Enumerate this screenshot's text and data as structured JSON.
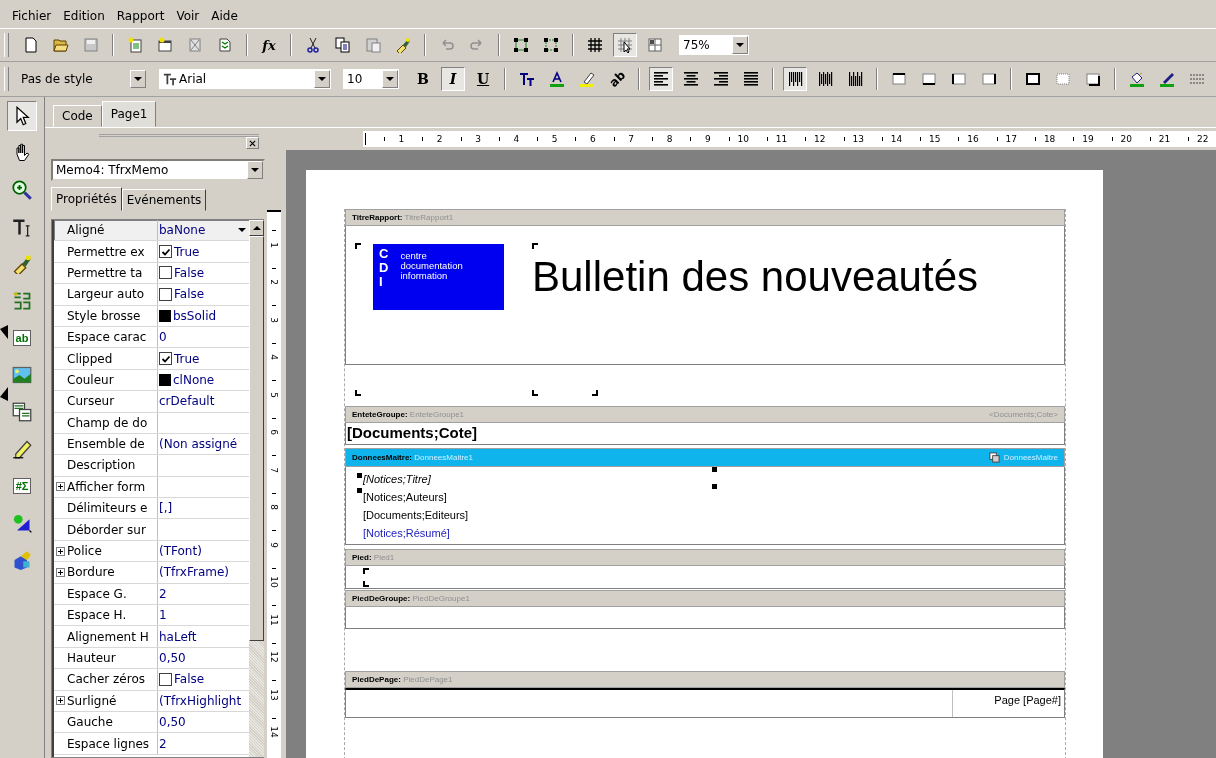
{
  "menu": [
    "Fichier",
    "Edition",
    "Rapport",
    "Voir",
    "Aide"
  ],
  "toolbar_main": {
    "groups": [
      [
        {
          "kind": "new",
          "pressed": false
        },
        {
          "kind": "open",
          "pressed": false
        },
        {
          "kind": "save",
          "pressed": false
        }
      ],
      [
        {
          "kind": "add-page",
          "pressed": false
        },
        {
          "kind": "add-dialog",
          "pressed": false
        },
        {
          "kind": "delete-page",
          "pressed": false
        },
        {
          "kind": "page-settings",
          "pressed": false
        }
      ],
      [
        {
          "kind": "expression",
          "label": "fx",
          "pressed": false
        }
      ],
      [
        {
          "kind": "cut",
          "pressed": false
        },
        {
          "kind": "copy",
          "pressed": false
        },
        {
          "kind": "paste",
          "pressed": false
        },
        {
          "kind": "format-painter",
          "pressed": false
        }
      ],
      [
        {
          "kind": "undo",
          "pressed": false
        },
        {
          "kind": "redo",
          "pressed": false
        }
      ],
      [
        {
          "kind": "group",
          "pressed": false
        },
        {
          "kind": "ungroup",
          "pressed": false
        }
      ],
      [
        {
          "kind": "grid",
          "pressed": false
        },
        {
          "kind": "snap",
          "pressed": true
        },
        {
          "kind": "fit",
          "pressed": false
        }
      ]
    ],
    "zoom": "75%"
  },
  "toolbar_format": {
    "style": "Pas de style",
    "font": "Arial",
    "size": "10",
    "text_buttons": [
      {
        "label": "B",
        "kind": "bold",
        "pressed": false
      },
      {
        "label": "I",
        "kind": "italic",
        "pressed": true
      },
      {
        "label": "U",
        "kind": "underline",
        "pressed": false
      }
    ],
    "groups": [
      [
        {
          "kind": "text-style",
          "pressed": false
        },
        {
          "kind": "font-color",
          "pressed": false
        },
        {
          "kind": "highlight",
          "pressed": false
        },
        {
          "kind": "rotate",
          "label": "ab",
          "pressed": false
        }
      ],
      [
        {
          "kind": "align-left",
          "pressed": true
        },
        {
          "kind": "align-center",
          "pressed": false
        },
        {
          "kind": "align-right",
          "pressed": false
        },
        {
          "kind": "justify",
          "pressed": false
        }
      ],
      [
        {
          "kind": "valign-top",
          "pressed": true
        },
        {
          "kind": "valign-center",
          "pressed": false
        },
        {
          "kind": "valign-bottom",
          "pressed": false
        }
      ],
      [
        {
          "kind": "frame-top",
          "pressed": false
        },
        {
          "kind": "frame-bottom",
          "pressed": false
        },
        {
          "kind": "frame-left",
          "pressed": false
        },
        {
          "kind": "frame-right",
          "pressed": false
        }
      ],
      [
        {
          "kind": "frame-all",
          "pressed": false
        },
        {
          "kind": "frame-none",
          "pressed": false
        },
        {
          "kind": "shadow",
          "pressed": false
        }
      ],
      [
        {
          "kind": "fill-color",
          "pressed": false
        },
        {
          "kind": "line-color",
          "pressed": false
        },
        {
          "kind": "line-style",
          "pressed": false
        }
      ]
    ]
  },
  "palette": [
    {
      "kind": "pointer",
      "selected": true
    },
    {
      "kind": "hand",
      "selected": false
    },
    {
      "kind": "zoom",
      "selected": false
    },
    {
      "kind": "text",
      "selected": false
    },
    {
      "kind": "brush",
      "selected": false
    },
    {
      "kind": "band",
      "selected": false
    },
    {
      "kind": "memo",
      "label": "ab",
      "selected": false
    },
    {
      "kind": "picture",
      "selected": false
    },
    {
      "kind": "list",
      "selected": false
    },
    {
      "kind": "line",
      "selected": false
    },
    {
      "kind": "sum",
      "label": "#Σ",
      "selected": false
    },
    {
      "kind": "shape",
      "selected": false
    },
    {
      "kind": "chart",
      "selected": false
    }
  ],
  "tabs": [
    {
      "label": "Code",
      "selected": false
    },
    {
      "label": "Page1",
      "selected": true
    }
  ],
  "inspector": {
    "object": "Memo4: TfrxMemo",
    "tabs": [
      {
        "label": "Propriétés",
        "selected": true
      },
      {
        "label": "Evénements",
        "selected": false
      }
    ],
    "rows": [
      {
        "name": "Aligné",
        "value": "baNone",
        "kind": "dropdown",
        "expandable": false,
        "selected": true
      },
      {
        "name": "Permettre ex",
        "value": "True",
        "kind": "check",
        "checked": true,
        "expandable": false,
        "selected": false
      },
      {
        "name": "Permettre ta",
        "value": "False",
        "kind": "check",
        "checked": false,
        "expandable": false,
        "selected": false
      },
      {
        "name": "Largeur auto",
        "value": "False",
        "kind": "check",
        "checked": false,
        "expandable": false,
        "selected": false
      },
      {
        "name": "Style brosse",
        "value": "bsSolid",
        "kind": "swatch",
        "expandable": false,
        "selected": false
      },
      {
        "name": "Espace carac",
        "value": "0",
        "kind": "text",
        "expandable": false,
        "selected": false
      },
      {
        "name": "Clipped",
        "value": "True",
        "kind": "check",
        "checked": true,
        "expandable": false,
        "selected": false
      },
      {
        "name": "Couleur",
        "value": "clNone",
        "kind": "swatch",
        "expandable": false,
        "selected": false
      },
      {
        "name": "Curseur",
        "value": "crDefault",
        "kind": "text",
        "expandable": false,
        "selected": false
      },
      {
        "name": "Champ de do",
        "kind": "text",
        "expandable": false,
        "selected": false
      },
      {
        "name": "Ensemble de",
        "value": "(Non assigné",
        "kind": "text",
        "expandable": false,
        "selected": false
      },
      {
        "name": "Description",
        "kind": "text",
        "expandable": false,
        "selected": false
      },
      {
        "name": "Afficher form",
        "kind": "text",
        "expandable": true,
        "selected": false
      },
      {
        "name": "Délimiteurs e",
        "value": "[,]",
        "kind": "text",
        "expandable": false,
        "selected": false
      },
      {
        "name": "Déborder sur",
        "kind": "text",
        "expandable": false,
        "selected": false
      },
      {
        "name": "Police",
        "value": "(TFont)",
        "kind": "text",
        "expandable": true,
        "selected": false
      },
      {
        "name": "Bordure",
        "value": "(TfrxFrame)",
        "kind": "text",
        "expandable": true,
        "selected": false
      },
      {
        "name": "Espace G.",
        "value": "2",
        "kind": "text",
        "expandable": false,
        "selected": false
      },
      {
        "name": "Espace H.",
        "value": "1",
        "kind": "text",
        "expandable": false,
        "selected": false
      },
      {
        "name": "Alignement H",
        "value": "haLeft",
        "kind": "text",
        "expandable": false,
        "selected": false
      },
      {
        "name": "Hauteur",
        "value": "0,50",
        "kind": "text",
        "expandable": false,
        "selected": false
      },
      {
        "name": "Cacher zéros",
        "value": "False",
        "kind": "check",
        "checked": false,
        "expandable": false,
        "selected": false
      },
      {
        "name": "Surligné",
        "value": "(TfrxHighlight",
        "kind": "text",
        "expandable": true,
        "selected": false
      },
      {
        "name": "Gauche",
        "value": "0,50",
        "kind": "text",
        "expandable": false,
        "selected": false
      },
      {
        "name": "Espace lignes",
        "value": "2",
        "kind": "text",
        "expandable": false,
        "selected": false
      }
    ]
  },
  "rulers": {
    "horizontal": [
      "1",
      "2",
      "3",
      "4",
      "5",
      "6",
      "7",
      "8",
      "9",
      "10",
      "11",
      "12",
      "13",
      "14",
      "15",
      "16",
      "17",
      "18",
      "19",
      "20",
      "21",
      "22"
    ],
    "vertical": [
      "1",
      "2",
      "3",
      "4",
      "5",
      "6",
      "7",
      "8",
      "9",
      "10",
      "11",
      "12",
      "13",
      "14"
    ]
  },
  "bands": [
    {
      "kind": "title",
      "type": "TitreRapport:",
      "name": "TitreRapport1",
      "selected": false,
      "logo": {
        "letters": [
          "C",
          "D",
          "I"
        ],
        "lines": [
          "centre",
          "documentation",
          "information"
        ]
      },
      "title": "Bulletin des nouveautés"
    },
    {
      "kind": "group_header",
      "type": "EnteteGroupe:",
      "name": "EnteteGroupe1",
      "condition": "<Documents;Cote>",
      "selected": false,
      "field": "[Documents;Cote]"
    },
    {
      "kind": "master_data",
      "type": "DonneesMaitre:",
      "name": "DonneesMaitre1",
      "dataset": "DonneesMaitre",
      "selected": true,
      "fields": [
        {
          "text": "[Notices;Titre]",
          "kind": "italic"
        },
        {
          "text": "[Notices;Auteurs]",
          "kind": "plain"
        },
        {
          "text": "[Documents;Editeurs]",
          "kind": "plain"
        },
        {
          "text": "[Notices;Résumé]",
          "kind": "blue"
        }
      ]
    },
    {
      "kind": "footer",
      "type": "Pied:",
      "name": "Pied1",
      "selected": false
    },
    {
      "kind": "group_footer",
      "type": "PiedDeGroupe:",
      "name": "PiedDeGroupe1",
      "selected": false
    },
    {
      "kind": "page_footer",
      "type": "PiedDePage:",
      "name": "PiedDePage1",
      "selected": false,
      "page_text": "Page [Page#]"
    }
  ]
}
